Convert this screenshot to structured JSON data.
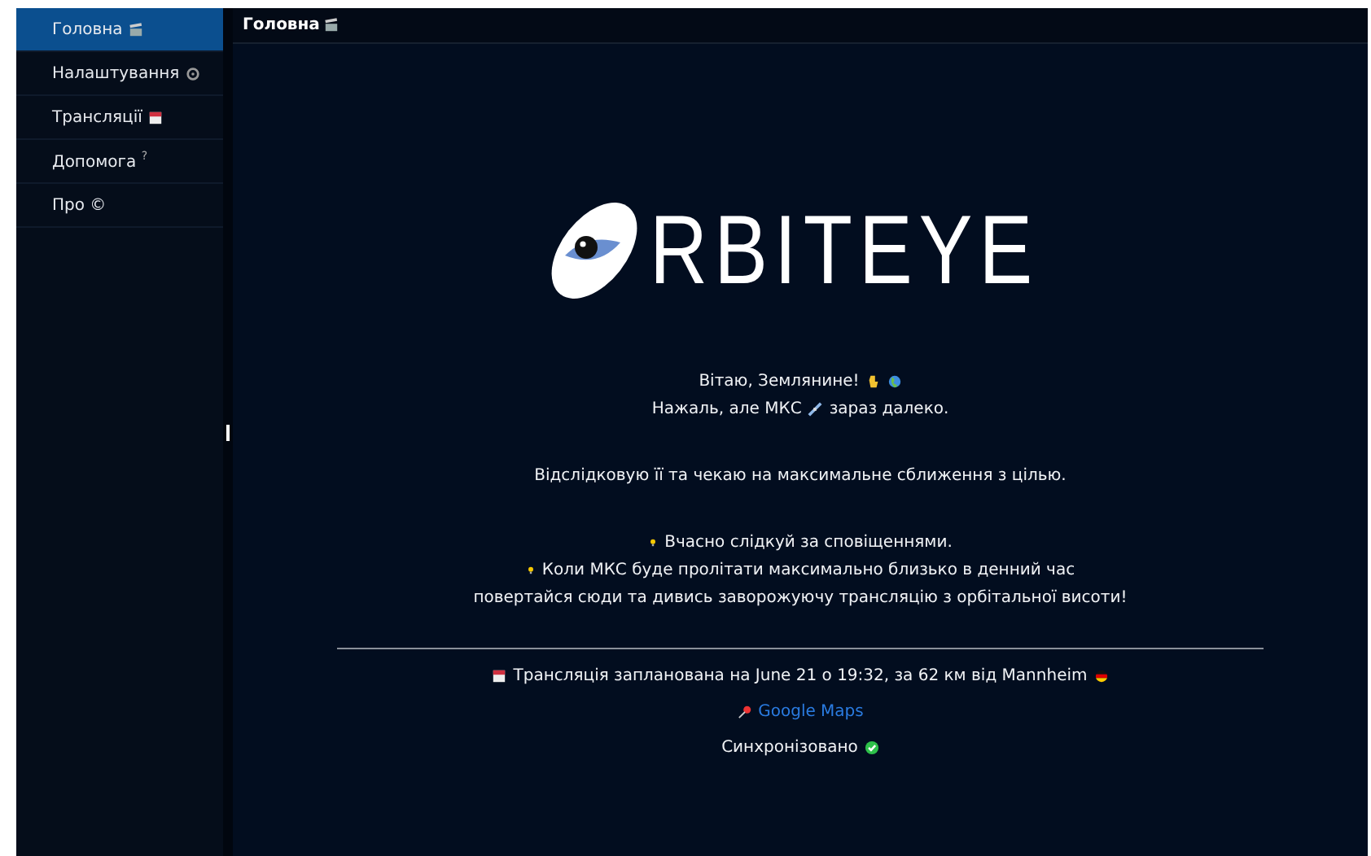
{
  "sidebar": {
    "items": [
      {
        "label": "Головна",
        "selected": true
      },
      {
        "label": "Налаштування",
        "selected": false
      },
      {
        "label": "Трансляції",
        "selected": false
      },
      {
        "label": "Допомога $^{?}$",
        "selected": false
      },
      {
        "label": "Про ©",
        "selected": false
      }
    ]
  },
  "header": {
    "title": "Головна"
  },
  "logo": {
    "text": "RBITEYE"
  },
  "message_groups": [
    [
      {
        "text": "Вітаю, Землянине!"
      },
      {
        "text": "Нажаль, але МКС",
        "text_after": "зараз далеко."
      }
    ],
    [
      {
        "text": "Відслідковую її та чекаю на максимальне сближення з цілью."
      }
    ],
    [
      {
        "text": "Вчасно слідкуй за сповіщеннями."
      },
      {
        "text": "Коли МКС буде пролітати максимально близько в денний час"
      },
      {
        "text": "повертайся сюди та дивись заворожуючу трансляцію з орбітальної висоти!"
      }
    ]
  ],
  "schedule": {
    "text": "Трансляція запланована на June 21 о 19:32, за 62 км від Mannheim"
  },
  "map_link": "Google Maps",
  "sync_status": "Синхронізовано"
}
